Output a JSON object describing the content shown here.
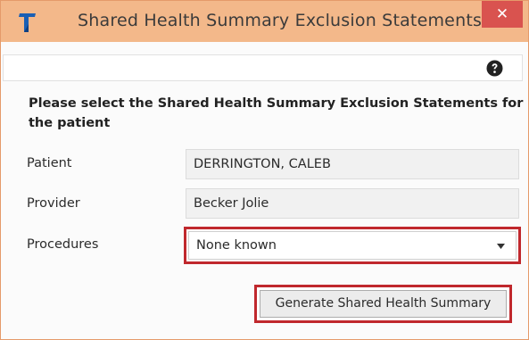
{
  "window": {
    "title": "Shared Health Summary Exclusion Statements",
    "close_glyph": "✕",
    "icons": {
      "logo": "telstra-logo-icon",
      "help": "help-icon",
      "close": "close-icon"
    }
  },
  "form": {
    "instructions": "Please select the Shared Health Summary Exclusion Statements for the patient",
    "patient_label": "Patient",
    "patient_value": "DERRINGTON, CALEB",
    "provider_label": "Provider",
    "provider_value": "Becker Jolie",
    "procedures_label": "Procedures",
    "procedures_value": "None known"
  },
  "actions": {
    "generate_label": "Generate Shared Health Summary"
  },
  "colors": {
    "titlebar": "#f3b88a",
    "close_button": "#d9534f",
    "highlight": "#c0282d",
    "logo": "#1a5fb4"
  }
}
